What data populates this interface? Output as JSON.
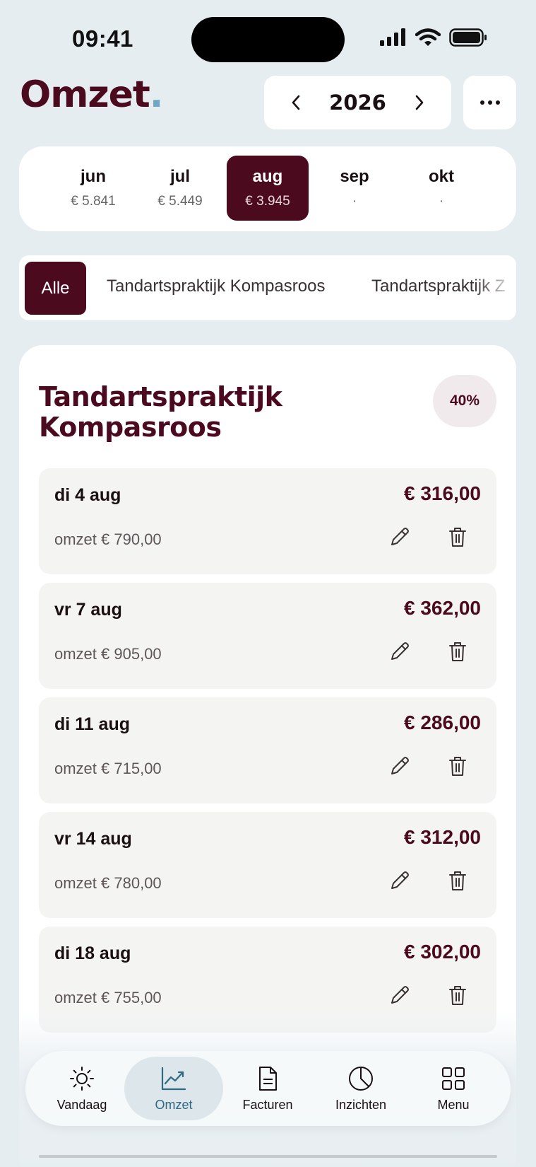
{
  "status_bar": {
    "time": "09:41"
  },
  "header": {
    "brand": "Omzet",
    "brand_dot": ".",
    "year": "2026",
    "prev_icon": "chevron-left-icon",
    "next_icon": "chevron-right-icon",
    "more_icon": "more-horizontal-icon"
  },
  "months": [
    {
      "name": "jun",
      "value": "€ 5.841"
    },
    {
      "name": "jul",
      "value": "€ 5.449"
    },
    {
      "name": "aug",
      "value": "€ 3.945",
      "selected": true
    },
    {
      "name": "sep",
      "value": "·"
    },
    {
      "name": "okt",
      "value": "·"
    }
  ],
  "filters": {
    "all": "Alle",
    "tabs": [
      "Tandartspraktijk Kompasroos",
      "Tandartspraktijk Z"
    ]
  },
  "card": {
    "title": "Tandartspraktijk Kompasroos",
    "percentage": "40%",
    "entries": [
      {
        "date": "di 4 aug",
        "amount": "€ 316,00",
        "turnover": "omzet € 790,00"
      },
      {
        "date": "vr 7 aug",
        "amount": "€ 362,00",
        "turnover": "omzet € 905,00"
      },
      {
        "date": "di 11 aug",
        "amount": "€ 286,00",
        "turnover": "omzet € 715,00"
      },
      {
        "date": "vr 14 aug",
        "amount": "€ 312,00",
        "turnover": "omzet € 780,00"
      },
      {
        "date": "di 18 aug",
        "amount": "€ 302,00",
        "turnover": "omzet € 755,00"
      }
    ]
  },
  "nav": {
    "items": [
      {
        "label": "Vandaag",
        "icon": "sun-icon"
      },
      {
        "label": "Omzet",
        "icon": "chart-line-icon",
        "active": true
      },
      {
        "label": "Facturen",
        "icon": "document-icon"
      },
      {
        "label": "Inzichten",
        "icon": "pie-chart-icon"
      },
      {
        "label": "Menu",
        "icon": "grid-icon"
      }
    ]
  },
  "colors": {
    "brand": "#4b0a1d",
    "accent": "#6fa8c4",
    "active_nav": "#2f6984",
    "background": "#e6edf1"
  }
}
